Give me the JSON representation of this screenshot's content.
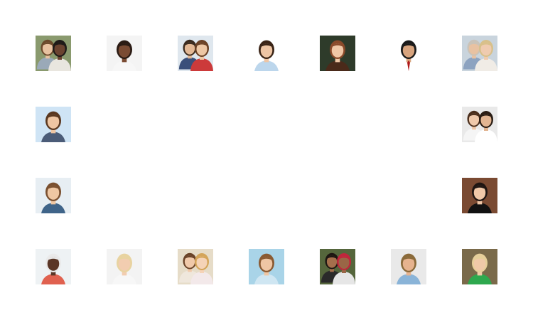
{
  "photos": [
    {
      "id": "couple-1",
      "bg": "#8a9a6e",
      "skin": "#e7c2a0",
      "hair": "#6b4a2b",
      "shirt": "#9aa9b8",
      "skin2": "#6b4330",
      "hair2": "#1e1a18",
      "shirt2": "#e9e6df"
    },
    {
      "id": "woman-1",
      "bg": "#f4f4f4",
      "skin": "#7a4b33",
      "hair": "#2a1b14",
      "shirt": "#f7f7f7"
    },
    {
      "id": "family-1",
      "bg": "#dfe7ee",
      "skin": "#e3b895",
      "hair": "#3a2a1e",
      "shirt": "#3b4f7a",
      "skin2": "#edc7a5",
      "hair2": "#6a4126",
      "shirt2": "#cc3a3a"
    },
    {
      "id": "woman-2",
      "bg": "#ffffff",
      "skin": "#eec5a4",
      "hair": "#3a2416",
      "shirt": "#bcd6ec"
    },
    {
      "id": "woman-3",
      "bg": "#2e3b2a",
      "skin": "#f0c7a6",
      "hair": "#8a4a2a",
      "shirt": "#4a2a1a"
    },
    {
      "id": "man-1",
      "bg": "#ffffff",
      "skin": "#d8a47e",
      "hair": "#1a1a1a",
      "shirt": "#ffffff",
      "tie": "#b01b1b"
    },
    {
      "id": "couple-2",
      "bg": "#c9d4dd",
      "skin": "#e8c2a2",
      "hair": "#c9c3b9",
      "shirt": "#8da3c0",
      "skin2": "#efcbb0",
      "hair2": "#d8c08a",
      "shirt2": "#f0ece6"
    },
    {
      "id": "woman-4",
      "bg": "#cfe4f5",
      "skin": "#efc6a3",
      "hair": "#5a3820",
      "shirt": "#4b5c78"
    },
    {
      "id": "couple-3",
      "bg": "#e9e9e9",
      "skin": "#efc9ab",
      "hair": "#4a2e1c",
      "shirt": "#f5f5f5",
      "skin2": "#e2b592",
      "hair2": "#2a1d14",
      "shirt2": "#ffffff"
    },
    {
      "id": "woman-5",
      "bg": "#e7eef3",
      "skin": "#efc7a3",
      "hair": "#7a5030",
      "shirt": "#3f6489"
    },
    {
      "id": "woman-6",
      "bg": "#7a4a32",
      "skin": "#f0c8a8",
      "hair": "#1e1512",
      "shirt": "#121212"
    },
    {
      "id": "man-2",
      "bg": "#eef2f4",
      "skin": "#5a3626",
      "hair": "#eaeaea",
      "shirt": "#e0614f"
    },
    {
      "id": "woman-7",
      "bg": "#f3f3f3",
      "skin": "#f2cdb0",
      "hair": "#e8d3a0",
      "shirt": "#f7f7f7"
    },
    {
      "id": "mother-child",
      "bg": "#e6dcc8",
      "skin": "#f0c9aa",
      "hair": "#6a4328",
      "shirt": "#efe7dc",
      "skin2": "#f5d3b7",
      "hair2": "#d4a55a",
      "shirt2": "#f3e9ea"
    },
    {
      "id": "woman-8",
      "bg": "#a9d4e8",
      "skin": "#efc6a4",
      "hair": "#8a5a32",
      "shirt": "#cfe6f2"
    },
    {
      "id": "couple-4",
      "bg": "#55663c",
      "skin": "#a56f4c",
      "hair": "#1d1612",
      "shirt": "#2a2a2a",
      "skin2": "#9a6646",
      "hair2": "#c0263c",
      "shirt2": "#e6e6e6"
    },
    {
      "id": "man-3",
      "bg": "#e9e9e9",
      "skin": "#e6b38f",
      "hair": "#8a6a3a",
      "shirt": "#8ab4d8"
    },
    {
      "id": "woman-9",
      "bg": "#7a6a4a",
      "skin": "#f0c9a8",
      "hair": "#e6cf9a",
      "shirt": "#2ea84e"
    }
  ]
}
